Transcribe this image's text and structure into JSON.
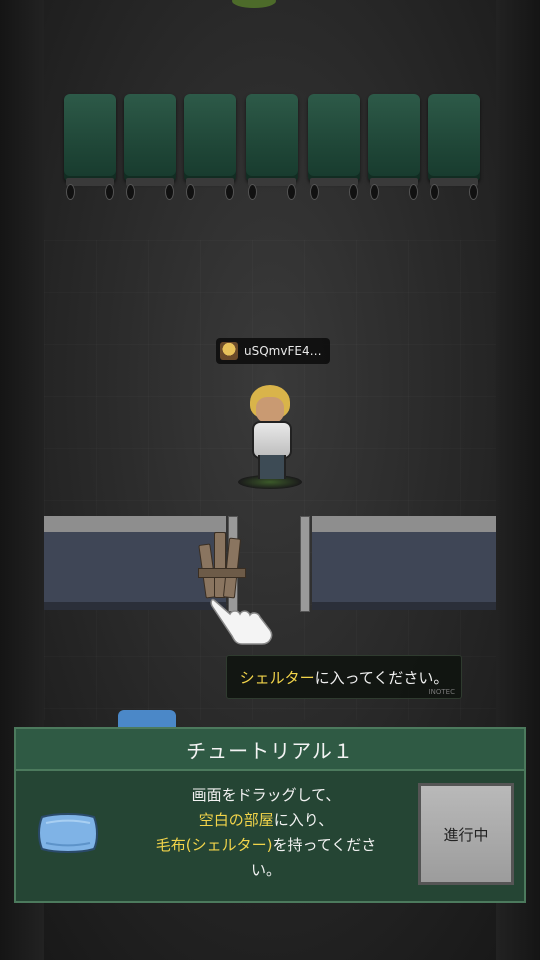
{
  "player": {
    "name": "uSQmvFE4…"
  },
  "hint": {
    "highlight": "シェルター",
    "rest": "に入ってください。",
    "tag": "INOTEC"
  },
  "tutorial": {
    "title": "チュートリアル１",
    "line1": "画面をドラッグして、",
    "line2_highlight": "空白の部屋",
    "line2_rest": "に入り、",
    "line3_highlight": "毛布(シェルター)",
    "line3_rest": "を持ってくださ",
    "line4": "い。",
    "status_button": "進行中"
  },
  "icons": {
    "player_avatar": "player-avatar-icon",
    "shelter": "wooden-shelter-icon",
    "hand": "pointing-hand-icon",
    "blanket": "blanket-icon"
  },
  "colors": {
    "highlight": "#f2d44a",
    "panel_bg": "#254534",
    "panel_border": "#4c7a5d",
    "bed": "#1f4637"
  }
}
